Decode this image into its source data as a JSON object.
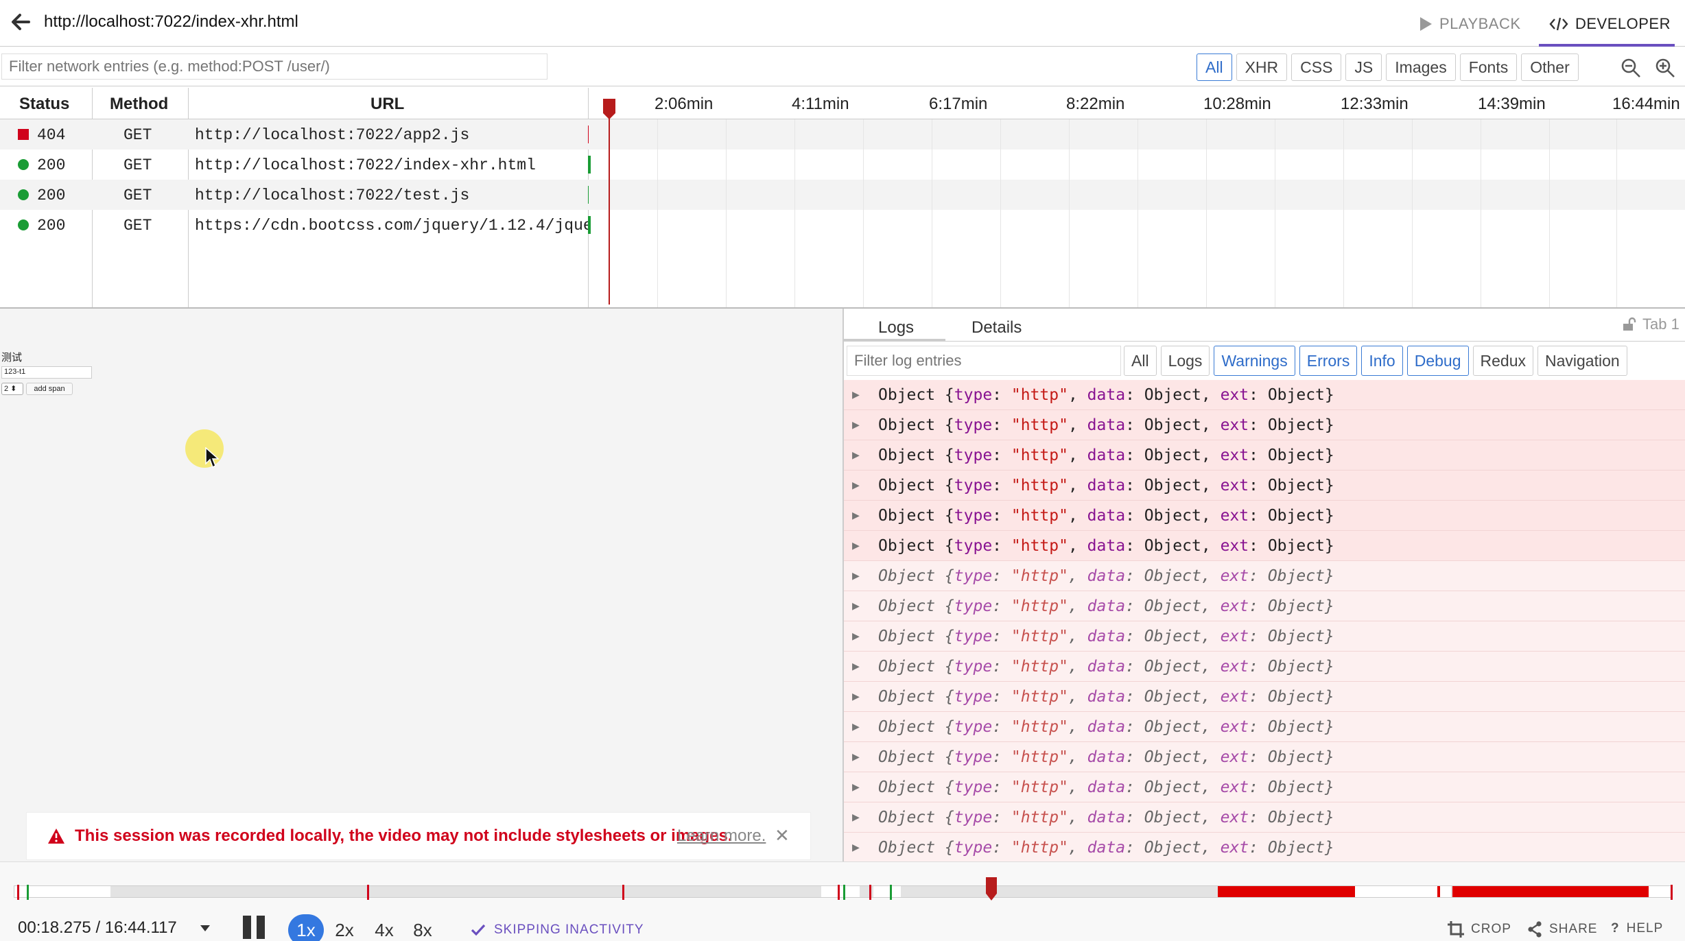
{
  "topbar": {
    "url": "http://localhost:7022/index-xhr.html",
    "tabs": {
      "playback": "PLAYBACK",
      "developer": "DEVELOPER"
    }
  },
  "network": {
    "filter_placeholder": "Filter network entries (e.g. method:POST /user/)",
    "filter_tabs": [
      "All",
      "XHR",
      "CSS",
      "JS",
      "Images",
      "Fonts",
      "Other"
    ],
    "active_filter": "All",
    "columns": {
      "status": "Status",
      "method": "Method",
      "url": "URL"
    },
    "timeline_ticks": [
      "2:06min",
      "4:11min",
      "6:17min",
      "8:22min",
      "10:28min",
      "12:33min",
      "14:39min",
      "16:44min"
    ],
    "rows": [
      {
        "status": "404",
        "method": "GET",
        "url": "http://localhost:7022/app2.js",
        "state": "error"
      },
      {
        "status": "200",
        "method": "GET",
        "url": "http://localhost:7022/index-xhr.html",
        "state": "ok"
      },
      {
        "status": "200",
        "method": "GET",
        "url": "http://localhost:7022/test.js",
        "state": "ok"
      },
      {
        "status": "200",
        "method": "GET",
        "url": "https://cdn.bootcss.com/jquery/1.12.4/jquery.min.js",
        "state": "ok"
      }
    ]
  },
  "preview": {
    "title": "测试",
    "input_value": "123-t1",
    "select_value": "2",
    "button_label": "add span"
  },
  "alert": {
    "text": "This session was recorded locally, the video may not include stylesheets or images.",
    "link": "Learn more."
  },
  "logs": {
    "tabs": {
      "logs": "Logs",
      "details": "Details"
    },
    "tab_indicator": "Tab 1",
    "filter_placeholder": "Filter log entries",
    "filter_buttons": [
      "All",
      "Logs",
      "Warnings",
      "Errors",
      "Info",
      "Debug",
      "Redux",
      "Navigation"
    ],
    "active_buttons": [
      "Warnings",
      "Errors",
      "Info",
      "Debug"
    ],
    "entry": {
      "prefix": "Object {",
      "type_key": "type",
      "type_val": "\"http\"",
      "data_key": "data",
      "data_val": "Object",
      "ext_key": "ext",
      "ext_val": "Object",
      "suffix": "}"
    },
    "entry_levels": [
      "error",
      "error",
      "error",
      "error",
      "error",
      "error",
      "debug",
      "debug",
      "debug",
      "debug",
      "debug",
      "debug",
      "debug",
      "debug",
      "debug",
      "debug"
    ]
  },
  "player": {
    "time": "00:18.275 / 16:44.117",
    "speeds": [
      "1x",
      "2x",
      "4x",
      "8x"
    ],
    "active_speed": "1x",
    "skipping": "SKIPPING INACTIVITY",
    "crop": "CROP",
    "share": "SHARE",
    "help": "HELP"
  },
  "colors": {
    "accent": "#6a4fbf",
    "error": "#d0021b",
    "ok": "#1a9c35",
    "active_blue": "#3478e0"
  }
}
